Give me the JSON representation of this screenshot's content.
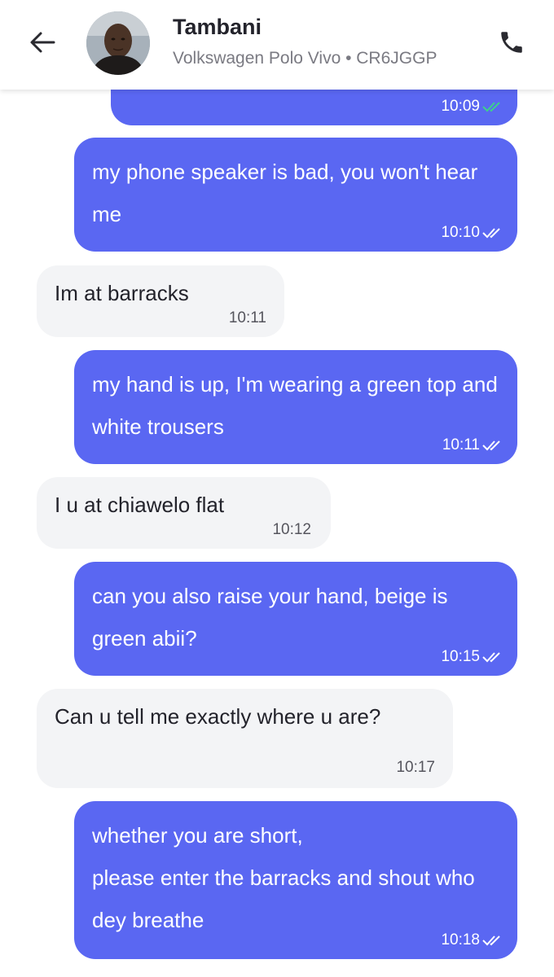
{
  "header": {
    "contact_name": "Tambani",
    "subtitle": "Volkswagen Polo Vivo • CR6JGGP",
    "back_icon": "arrow-left-icon",
    "call_icon": "phone-icon"
  },
  "colors": {
    "outgoing_bubble": "#5a67f2",
    "incoming_bubble": "#f3f4f6",
    "read_tick_green": "#3ecf8e"
  },
  "messages": [
    {
      "direction": "out",
      "text": "",
      "time": "10:09",
      "status": "read-green"
    },
    {
      "direction": "out",
      "text": "my phone speaker is bad, you won't hear me",
      "time": "10:10",
      "status": "read"
    },
    {
      "direction": "in",
      "text": "Im at barracks",
      "time": "10:11"
    },
    {
      "direction": "out",
      "text": "my hand is up, I'm wearing a green top and white trousers",
      "time": "10:11",
      "status": "read"
    },
    {
      "direction": "in",
      "text": "I u at chiawelo flat",
      "time": "10:12"
    },
    {
      "direction": "out",
      "text": "can you also raise your hand,  beige is green abii?",
      "time": "10:15",
      "status": "read"
    },
    {
      "direction": "in",
      "text": "Can u tell me exactly where u are?",
      "time": "10:17"
    },
    {
      "direction": "out",
      "text": "whether you are short,\nplease enter the barracks and shout who dey breathe",
      "time": "10:18",
      "status": "read"
    }
  ]
}
